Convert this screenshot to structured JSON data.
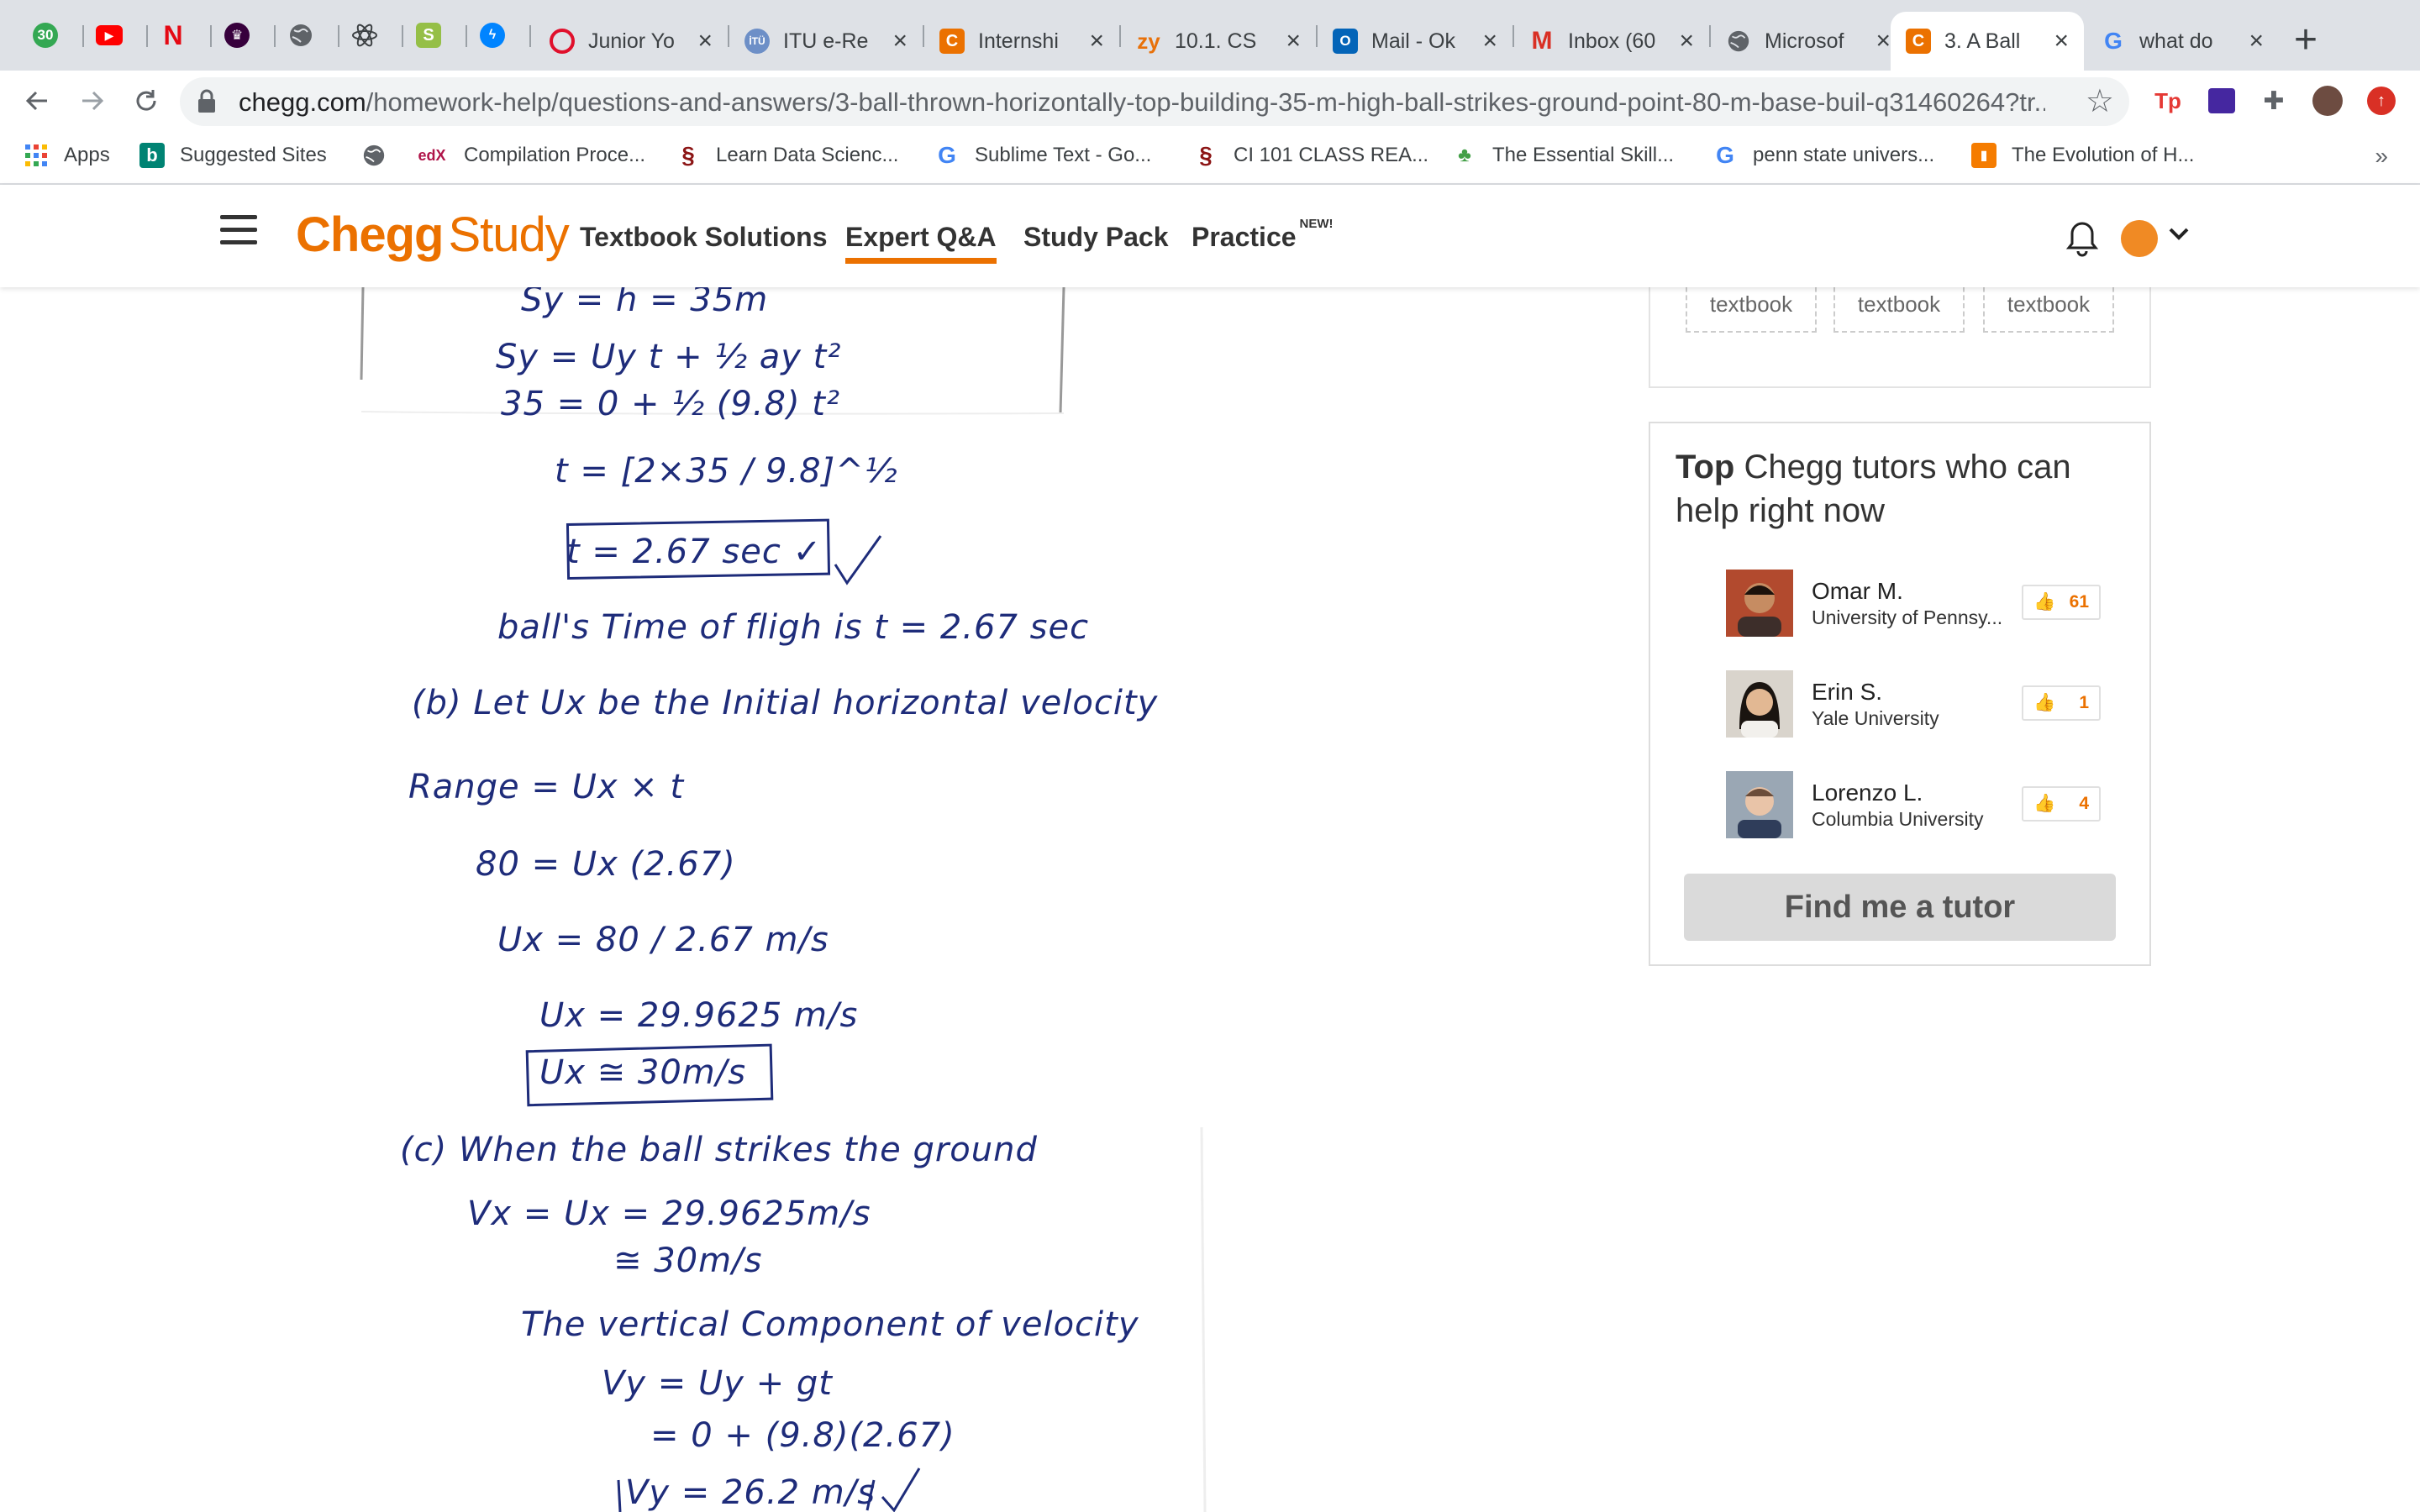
{
  "browser": {
    "tabs": [
      {
        "title": "Junior Yo",
        "favicon": "opera-circle-icon"
      },
      {
        "title": "ITU e-Re",
        "favicon": "itu-icon"
      },
      {
        "title": "Internshi",
        "favicon": "chegg-c-icon"
      },
      {
        "title": "10.1. CS",
        "favicon": "zybooks-icon"
      },
      {
        "title": "Mail - Ok",
        "favicon": "outlook-icon"
      },
      {
        "title": "Inbox (60",
        "favicon": "gmail-icon"
      },
      {
        "title": "Microsof",
        "favicon": "globe-icon"
      },
      {
        "title": "3. A Ball",
        "favicon": "chegg-c-icon",
        "active": true
      },
      {
        "title": "what do",
        "favicon": "google-icon"
      }
    ],
    "pinned_badge": "30",
    "url_host": "chegg.com",
    "url_path": "/homework-help/questions-and-answers/3-ball-thrown-horizontally-top-building-35-m-high-ball-strikes-ground-point-80-m-base-buil-q31460264?tr...",
    "bookmarks": [
      {
        "label": "Apps",
        "icon": "apps-grid-icon"
      },
      {
        "label": "Suggested Sites",
        "icon": "bing-icon"
      },
      {
        "label": "",
        "icon": "globe-icon"
      },
      {
        "label": "Compilation Proce...",
        "icon": "edx-icon"
      },
      {
        "label": "Learn Data Scienc...",
        "icon": "stanford-icon"
      },
      {
        "label": "Sublime Text - Go...",
        "icon": "google-icon"
      },
      {
        "label": "CI 101 CLASS REA...",
        "icon": "stanford-icon"
      },
      {
        "label": "The Essential Skill...",
        "icon": "leaf-icon"
      },
      {
        "label": "penn state univers...",
        "icon": "google-icon"
      },
      {
        "label": "The Evolution of H...",
        "icon": "orange-doc-icon"
      }
    ],
    "bookmarks_more": "»",
    "colors": {
      "chegg_orange": "#eb7100",
      "tab_strip": "#dee1e6"
    }
  },
  "header": {
    "logo_chegg": "Chegg",
    "logo_study": "Study",
    "nav": [
      {
        "label": "Textbook Solutions"
      },
      {
        "label": "Expert Q&A",
        "active": true
      },
      {
        "label": "Study Pack"
      },
      {
        "label": "Practice",
        "badge": "NEW!"
      }
    ]
  },
  "sidebar": {
    "textbook_tiles": [
      "textbook",
      "textbook",
      "textbook"
    ],
    "tutors_title_bold": "Top",
    "tutors_title_rest": " Chegg tutors who can help right now",
    "tutors": [
      {
        "name": "Omar M.",
        "school": "University of Pennsy...",
        "rating": "61"
      },
      {
        "name": "Erin S.",
        "school": "Yale University",
        "rating": "1"
      },
      {
        "name": "Lorenzo L.",
        "school": "Columbia University",
        "rating": "4"
      }
    ],
    "find_button": "Find me a tutor"
  },
  "solution": {
    "lines": [
      "Sy = h = 35m",
      "Sy = Uy t + ½ ay t²",
      "35 = 0 + ½ (9.8) t²",
      "t = [2×35 / 9.8]^½",
      "t = 2.67 sec ✓",
      "ball's Time of fligh  is t = 2.67 sec",
      "(b)  Let Ux be the Initial horizontal velocity",
      "Range = Ux × t",
      "80 = Ux (2.67)",
      "Ux = 80 / 2.67 m/s",
      "Ux = 29.9625 m/s",
      "Ux ≅ 30m/s",
      "(c)  When the ball strikes the ground",
      "Vx = Ux = 29.9625m/s",
      "≅ 30m/s",
      "The vertical Component of velocity",
      "Vy = Uy + gt",
      "= 0 + (9.8)(2.67)",
      "Vy = 26.2 m/s"
    ]
  }
}
